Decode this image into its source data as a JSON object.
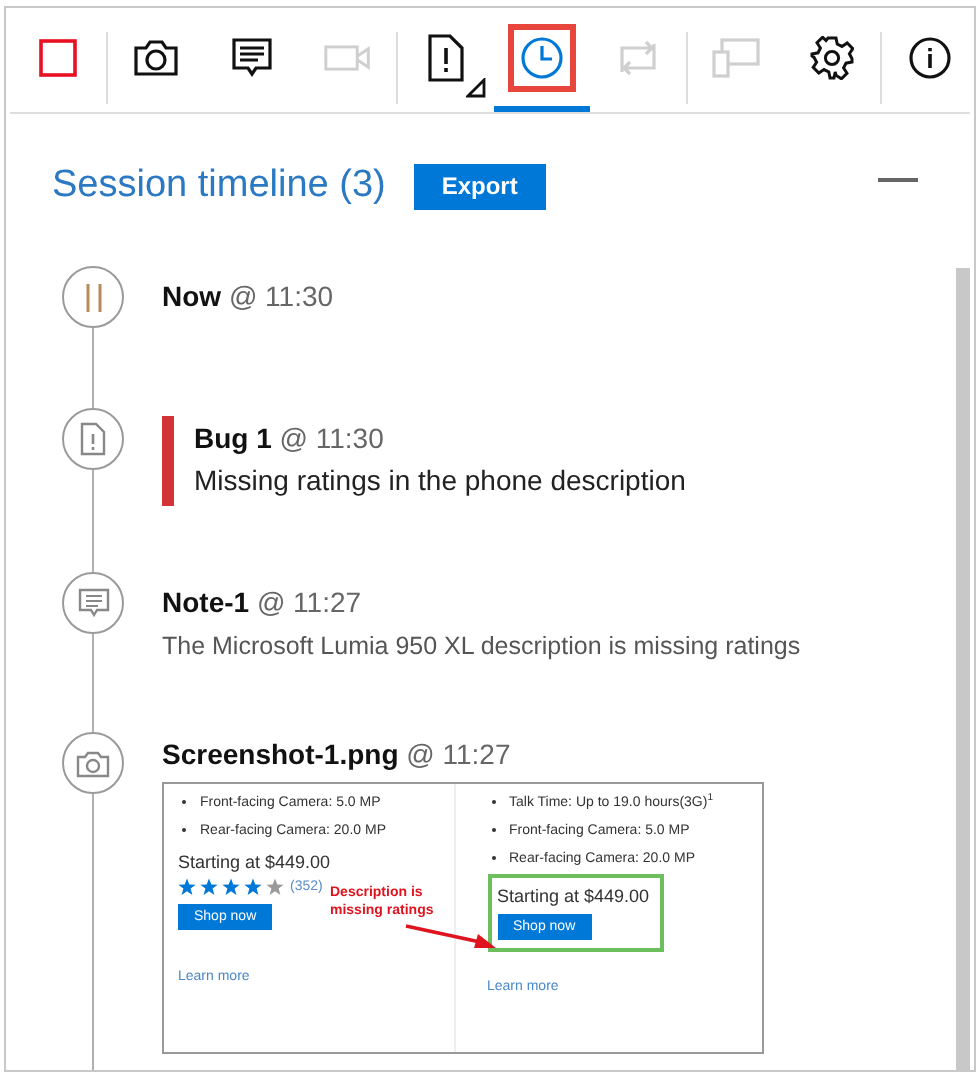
{
  "toolbar": {
    "groups": [
      {
        "tools": [
          {
            "kind": "stop",
            "selected": false,
            "disabled": false
          }
        ]
      },
      {
        "tools": [
          {
            "kind": "camera",
            "selected": false,
            "disabled": false
          },
          {
            "kind": "note",
            "selected": false,
            "disabled": false
          },
          {
            "kind": "video",
            "selected": false,
            "disabled": true
          }
        ]
      },
      {
        "tools": [
          {
            "kind": "bug",
            "selected": false,
            "disabled": false,
            "has_menu": true
          },
          {
            "kind": "timeline",
            "selected": true,
            "disabled": false
          },
          {
            "kind": "loop",
            "selected": false,
            "disabled": true
          }
        ]
      },
      {
        "tools": [
          {
            "kind": "device",
            "selected": false,
            "disabled": true
          },
          {
            "kind": "settings",
            "selected": false,
            "disabled": false
          }
        ]
      },
      {
        "tools": [
          {
            "kind": "info",
            "selected": false,
            "disabled": false
          }
        ]
      }
    ]
  },
  "header": {
    "title": "Session timeline (3)",
    "export_button": "Export"
  },
  "timeline": [
    {
      "kind": "now",
      "name": "Now",
      "time": "@ 11:30"
    },
    {
      "kind": "bug",
      "name": "Bug 1",
      "time": "@ 11:30",
      "description": "Missing ratings in the phone description"
    },
    {
      "kind": "note",
      "name": "Note-1",
      "time": "@ 11:27",
      "description": "The Microsoft Lumia 950 XL description is missing ratings"
    },
    {
      "kind": "screenshot",
      "name": "Screenshot-1.png",
      "time": "@ 11:27",
      "preview": {
        "left": {
          "bullets": [
            "Front-facing Camera: 5.0 MP",
            "Rear-facing Camera: 20.0 MP"
          ],
          "price": "Starting at $449.00",
          "stars": 4,
          "rating_count": "(352)",
          "button": "Shop now",
          "link": "Learn more"
        },
        "right": {
          "bullets": [
            "Talk Time: Up to 19.0 hours(3G)$^{1}$",
            "Front-facing Camera: 5.0 MP",
            "Rear-facing Camera: 20.0 MP"
          ],
          "price": "Starting at $449.00",
          "button": "Shop now",
          "link": "Learn more"
        },
        "annotation": "Description is missing ratings"
      }
    }
  ]
}
